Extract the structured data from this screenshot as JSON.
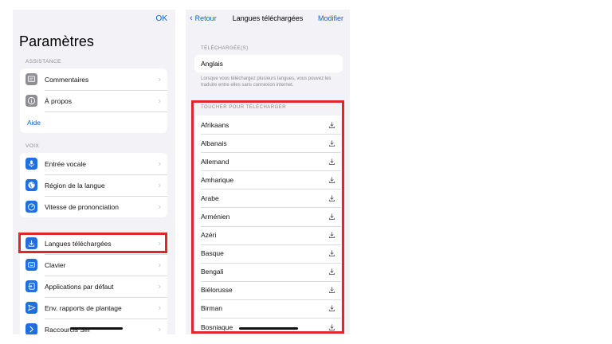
{
  "settings": {
    "ok_label": "OK",
    "title": "Paramètres",
    "assistance_header": "ASSISTANCE",
    "assistance_items": [
      {
        "label": "Commentaires",
        "icon": "feedback-icon",
        "color": "#8e8e93"
      },
      {
        "label": "À propos",
        "icon": "info-icon",
        "color": "#8e8e93"
      }
    ],
    "help_link": "Aide",
    "voice_header": "VOIX",
    "voice_items": [
      {
        "label": "Entrée vocale",
        "icon": "microphone-icon",
        "color": "#1f6fe0"
      },
      {
        "label": "Région de la langue",
        "icon": "globe-icon",
        "color": "#1f6fe0"
      },
      {
        "label": "Vitesse de prononciation",
        "icon": "speedometer-icon",
        "color": "#1f6fe0"
      }
    ],
    "other_items": [
      {
        "label": "Langues téléchargées",
        "icon": "download-icon",
        "color": "#1f6fe0"
      },
      {
        "label": "Clavier",
        "icon": "keyboard-icon",
        "color": "#1f6fe0"
      },
      {
        "label": "Applications par défaut",
        "icon": "default-apps-icon",
        "color": "#1f6fe0"
      },
      {
        "label": "Env. rapports de plantage",
        "icon": "send-icon",
        "color": "#1f6fe0"
      },
      {
        "label": "Raccourcis Siri",
        "icon": "siri-shortcuts-icon",
        "color": "#1f6fe0"
      }
    ]
  },
  "languages": {
    "back_label": "Retour",
    "title": "Langues téléchargées",
    "edit_label": "Modifier",
    "downloaded_header": "TÉLÉCHARGÉE(S)",
    "downloaded_items": [
      "Anglais"
    ],
    "footnote": "Lorsque vous téléchargez plusieurs langues, vous pouvez les traduire entre elles sans connexion internet.",
    "available_header": "TOUCHER POUR TÉLÉCHARGER",
    "available_items": [
      "Afrikaans",
      "Albanais",
      "Allemand",
      "Amharique",
      "Arabe",
      "Arménien",
      "Azéri",
      "Basque",
      "Bengali",
      "Biélorusse",
      "Birman",
      "Bosniaque"
    ]
  },
  "colors": {
    "highlight": "#e0262b",
    "link": "#0a63d8",
    "icon_blue": "#1f6fe0",
    "icon_gray": "#8e8e93"
  }
}
